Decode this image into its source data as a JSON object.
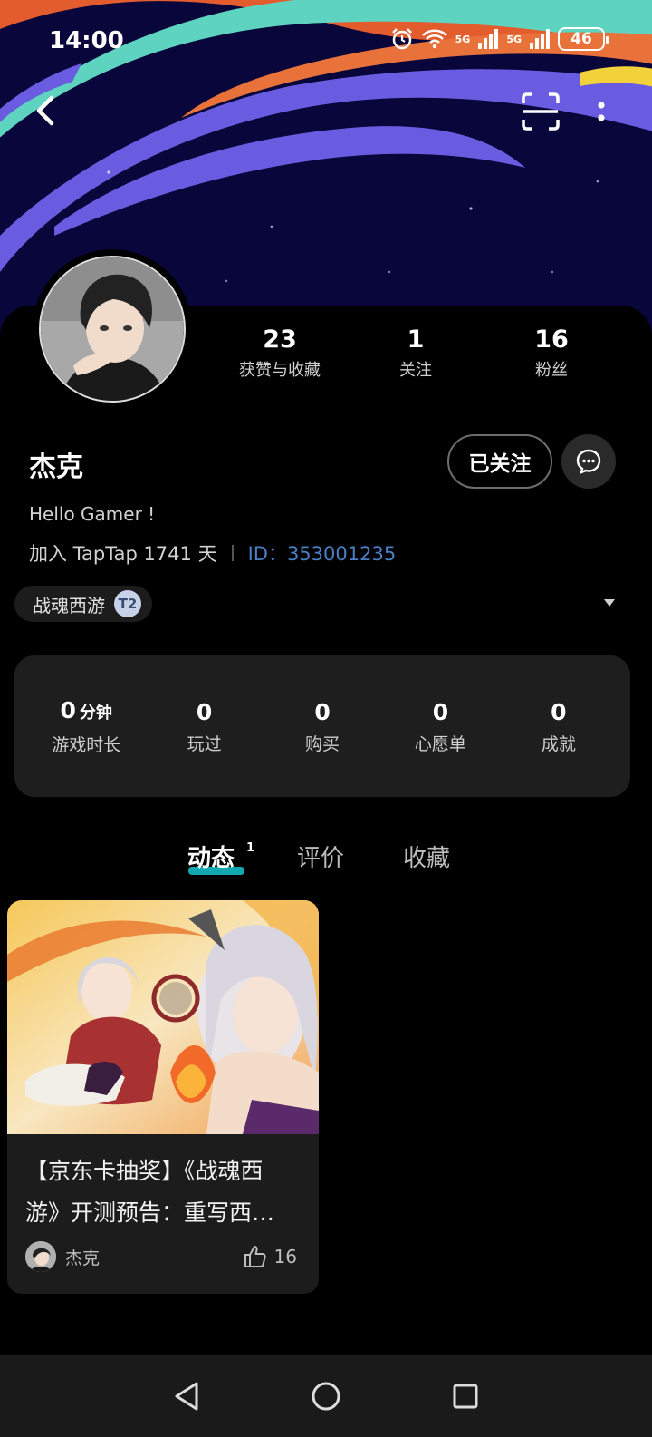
{
  "status_bar": {
    "time": "14:00",
    "signal1": "5G",
    "signal2": "5G",
    "battery": "46"
  },
  "profile": {
    "stats": [
      {
        "value": "23",
        "label": "获赞与收藏"
      },
      {
        "value": "1",
        "label": "关注"
      },
      {
        "value": "16",
        "label": "粉丝"
      }
    ],
    "username": "杰克",
    "follow_label": "已关注",
    "bio": "Hello Gamer !",
    "join_text": "加入 TapTap 1741 天",
    "id_text": "ID：353001235",
    "game_chip": {
      "name": "战魂西游",
      "badge": "T2"
    }
  },
  "game_stats": [
    {
      "value": "0",
      "unit": "分钟",
      "label": "游戏时长"
    },
    {
      "value": "0",
      "unit": "",
      "label": "玩过"
    },
    {
      "value": "0",
      "unit": "",
      "label": "购买"
    },
    {
      "value": "0",
      "unit": "",
      "label": "心愿单"
    },
    {
      "value": "0",
      "unit": "",
      "label": "成就"
    }
  ],
  "tabs": [
    {
      "label": "动态",
      "badge": "1"
    },
    {
      "label": "评价"
    },
    {
      "label": "收藏"
    }
  ],
  "post": {
    "title_line1": "【京东卡抽奖】《战魂西",
    "title_line2": "游》开测预告：重写西…",
    "author": "杰克",
    "likes": "16"
  },
  "colors": {
    "accent": "#15c5ce",
    "id_blue": "#4a7fc4",
    "banner_navy": "#08063a"
  }
}
